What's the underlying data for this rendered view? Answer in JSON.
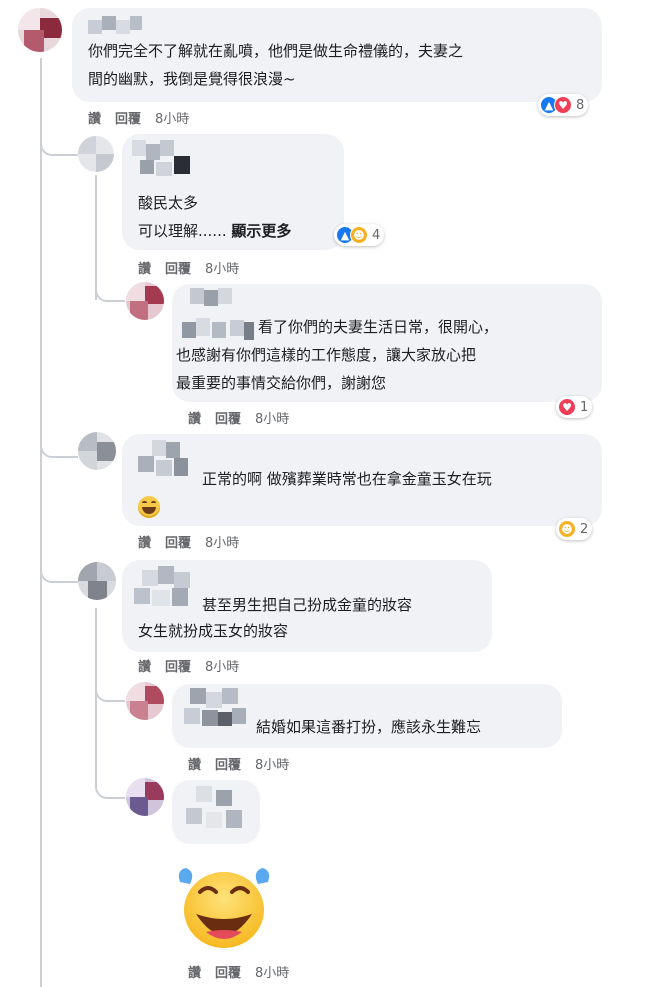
{
  "colors": {
    "bubble": "#f0f2f5",
    "meta": "#65676b",
    "like": "#1877f2",
    "love": "#f33e58",
    "haha": "#f7b125"
  },
  "comments": [
    {
      "line1": "你們完全不了解就在亂噴，他們是做生命禮儀的，夫妻之",
      "line2": "間的幽默，我倒是覺得很浪漫~",
      "like": "讚",
      "reply": "回覆",
      "time": "8小時",
      "reaction_count": "8",
      "reactions": [
        "like-icon",
        "love-icon"
      ]
    },
    {
      "line1": "酸民太多",
      "line2": "可以理解......",
      "see_more": "顯示更多",
      "like": "讚",
      "reply": "回覆",
      "time": "8小時",
      "reaction_count": "4",
      "reactions": [
        "like-icon",
        "haha-icon"
      ]
    },
    {
      "line1": "看了你們的夫妻生活日常，很開心，",
      "line2": "也感謝有你們這樣的工作態度，讓大家放心把",
      "line3": "最重要的事情交給你們，謝謝您",
      "like": "讚",
      "reply": "回覆",
      "time": "8小時",
      "reaction_count": "1",
      "reactions": [
        "love-icon"
      ]
    },
    {
      "line1": "正常的啊 做殯葬業時常也在拿金童玉女在玩",
      "like": "讚",
      "reply": "回覆",
      "time": "8小時",
      "reaction_count": "2",
      "reactions": [
        "haha-icon"
      ]
    },
    {
      "line1": "甚至男生把自己扮成金童的妝容",
      "line2": "女生就扮成玉女的妝容",
      "like": "讚",
      "reply": "回覆",
      "time": "8小時"
    },
    {
      "line1": "結婚如果這番打扮，應該永生難忘",
      "like": "讚",
      "reply": "回覆",
      "time": "8小時"
    },
    {
      "like": "讚",
      "reply": "回覆",
      "time": "8小時",
      "sticker": "laughing-crying-emoji"
    }
  ]
}
